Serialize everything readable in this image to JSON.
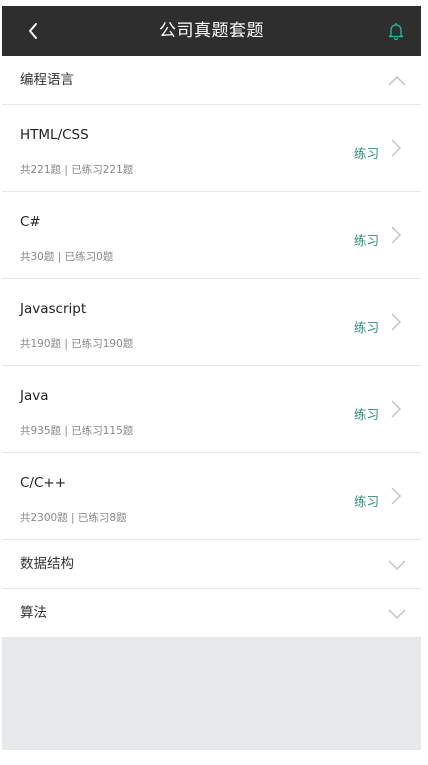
{
  "header": {
    "title": "公司真题套题",
    "accent_color": "#2fb89a",
    "back_icon": "chevron-left-icon",
    "bell_icon": "bell-icon"
  },
  "sections": [
    {
      "label": "编程语言",
      "expanded": true,
      "items": [
        {
          "name": "HTML/CSS",
          "stats": "共221题 | 已练习221题",
          "action": "练习"
        },
        {
          "name": "C#",
          "stats": "共30题 | 已练习0题",
          "action": "练习"
        },
        {
          "name": "Javascript",
          "stats": "共190题 | 已练习190题",
          "action": "练习"
        },
        {
          "name": "Java",
          "stats": "共935题 | 已练习115题",
          "action": "练习"
        },
        {
          "name": "C/C++",
          "stats": "共2300题 | 已练习8题",
          "action": "练习"
        }
      ]
    },
    {
      "label": "数据结构",
      "expanded": false
    },
    {
      "label": "算法",
      "expanded": false
    }
  ]
}
